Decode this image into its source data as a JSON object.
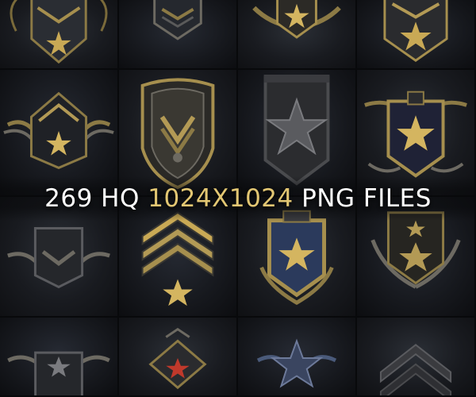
{
  "banner": {
    "prefix": "269 HQ ",
    "highlight": "1024X1024",
    "suffix": " PNG FILES"
  },
  "colors": {
    "accent_gold": "#e3c773",
    "banner_text": "#ffffff",
    "background": "#0e0f12"
  },
  "tiles": [
    {
      "icon": "winged-chevron-badge-icon"
    },
    {
      "icon": "chevron-emblem-icon"
    },
    {
      "icon": "winged-star-badge-icon"
    },
    {
      "icon": "star-chevron-shield-icon"
    },
    {
      "icon": "winged-star-chevron-icon"
    },
    {
      "icon": "laurel-shield-icon"
    },
    {
      "icon": "star-pennant-icon"
    },
    {
      "icon": "star-crest-icon"
    },
    {
      "icon": "winged-chevron-icon"
    },
    {
      "icon": "triple-chevron-star-icon"
    },
    {
      "icon": "star-shield-icon"
    },
    {
      "icon": "laurel-star-wreath-icon"
    },
    {
      "icon": "winged-star-insignia-icon"
    },
    {
      "icon": "red-diamond-badge-icon"
    },
    {
      "icon": "dark-star-badge-icon"
    },
    {
      "icon": "chevron-rank-icon"
    }
  ]
}
